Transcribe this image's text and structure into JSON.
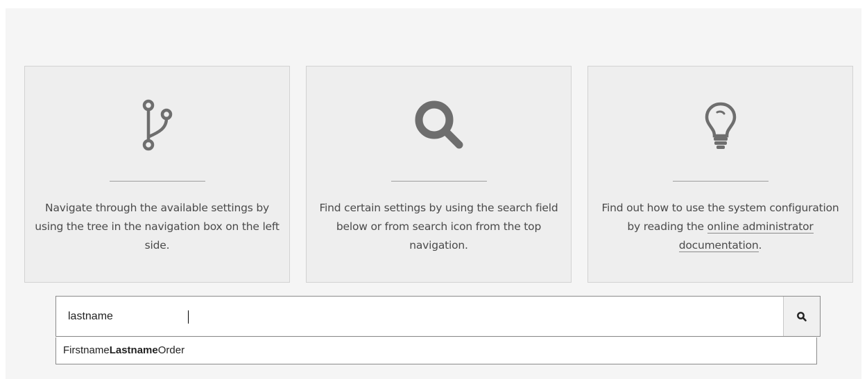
{
  "colors": {
    "panel_bg": "#f5f5f5",
    "card_bg": "#eeeeee",
    "card_border": "#d2d2d2",
    "icon_gray": "#6e6e6e",
    "text": "#4a4a4a"
  },
  "cards": [
    {
      "icon": "code-fork-icon",
      "text": "Navigate through the available settings by using the tree in the navigation box on the left side."
    },
    {
      "icon": "search-icon",
      "text": "Find certain settings by using the search field below or from search icon from the top navigation."
    },
    {
      "icon": "lightbulb-icon",
      "text_before": "Find out how to use the system configuration by reading the ",
      "link_label": "online administrator documentation",
      "text_after": "."
    }
  ],
  "search": {
    "value": "lastname",
    "button_icon": "search-icon"
  },
  "suggestions": [
    {
      "prefix": "Firstname",
      "match": "Lastname",
      "suffix": "Order"
    }
  ]
}
